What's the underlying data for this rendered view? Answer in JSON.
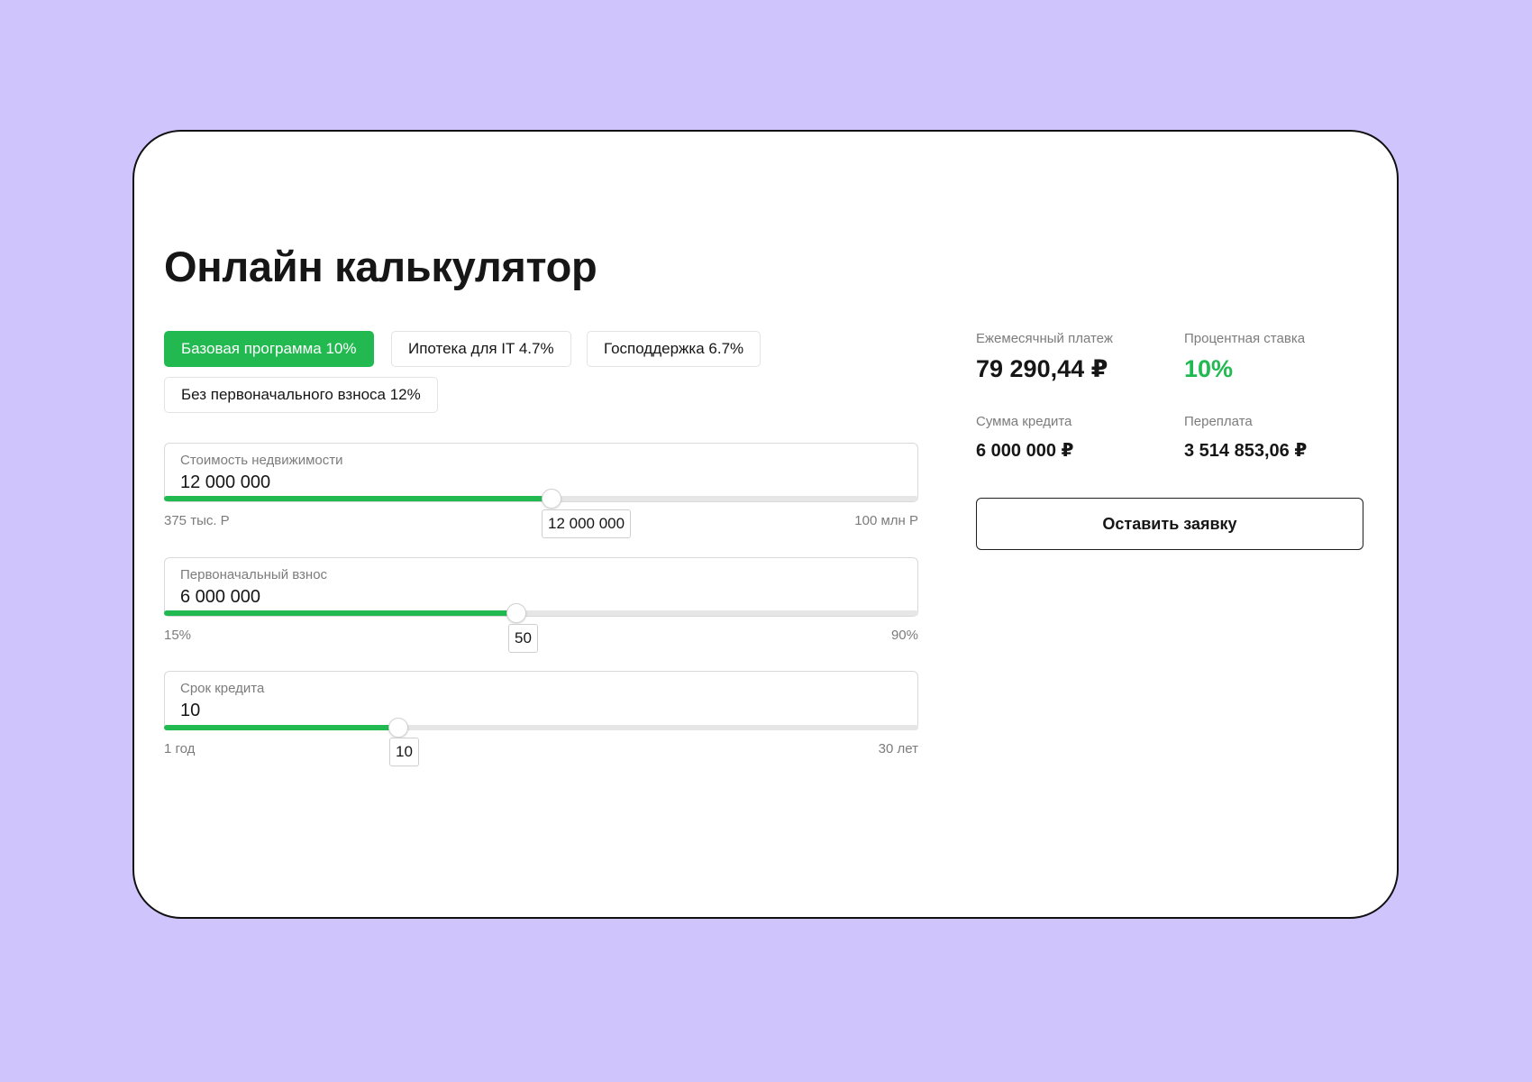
{
  "title": "Онлайн калькулятор",
  "programs": [
    {
      "label": "Базовая программа 10%",
      "active": true
    },
    {
      "label": "Ипотека для IT 4.7%",
      "active": false
    },
    {
      "label": "Господдержка 6.7%",
      "active": false
    },
    {
      "label": "Без первоначального взноса 12%",
      "active": false
    }
  ],
  "price": {
    "label": "Стоимость недвижимости",
    "value": "12 000 000",
    "tooltip": "12 000 000",
    "min_label": "375 тыс. Р",
    "max_label": "100 млн Р",
    "slider_fraction": 0.512
  },
  "down_payment": {
    "label": "Первоначальный взнос",
    "value": "6 000 000",
    "tooltip": "50",
    "min_label": "15%",
    "max_label": "90%",
    "slider_fraction": 0.466
  },
  "term": {
    "label": "Срок кредита",
    "value": "10",
    "tooltip": "10",
    "min_label": "1 год",
    "max_label": "30 лет",
    "slider_fraction": 0.31
  },
  "summary": {
    "monthly_label": "Ежемесячный платеж",
    "monthly_value": "79 290,44 ₽",
    "rate_label": "Процентная ставка",
    "rate_value": "10%",
    "loan_label": "Сумма кредита",
    "loan_value": "6 000 000 ₽",
    "overpay_label": "Переплата",
    "overpay_value": "3 514 853,06 ₽"
  },
  "cta_label": "Оставить заявку",
  "colors": {
    "accent": "#22ba50",
    "background": "#d0c4fd",
    "card": "#ffffff",
    "text": "#161616",
    "muted": "#7c7c7c"
  }
}
